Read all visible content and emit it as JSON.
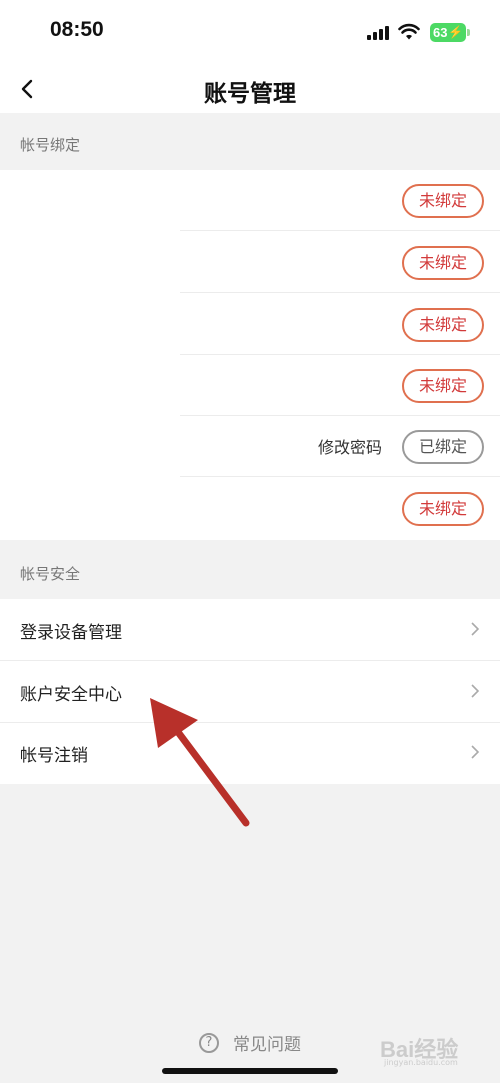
{
  "status": {
    "time": "08:50",
    "battery": "63"
  },
  "nav": {
    "title": "账号管理"
  },
  "sections": {
    "binding_header": "帐号绑定",
    "security_header": "帐号安全"
  },
  "bindings": [
    {
      "label": "",
      "status": "未绑定",
      "state": "unbound"
    },
    {
      "label": "",
      "status": "未绑定",
      "state": "unbound"
    },
    {
      "label": "",
      "status": "未绑定",
      "state": "unbound"
    },
    {
      "label": "",
      "status": "未绑定",
      "state": "unbound"
    },
    {
      "label": "修改密码",
      "status": "已绑定",
      "state": "bound"
    },
    {
      "label": "",
      "status": "未绑定",
      "state": "unbound"
    }
  ],
  "security_items": [
    {
      "label": "登录设备管理"
    },
    {
      "label": "账户安全中心"
    },
    {
      "label": "帐号注销"
    }
  ],
  "footer": {
    "faq_label": "常见问题"
  },
  "watermark": {
    "text": "Bai经验",
    "sub": "jingyan.baidu.com"
  },
  "colors": {
    "unbound_accent": "#e0704f",
    "unbound_text": "#d23a3a",
    "annotation_arrow": "#c0392b"
  }
}
